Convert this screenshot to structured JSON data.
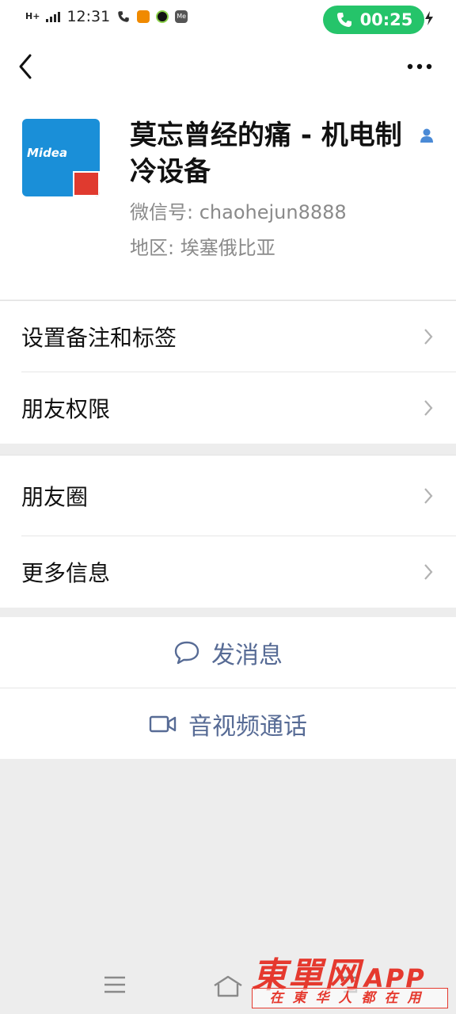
{
  "status_bar": {
    "network": "H+",
    "time": "12:31",
    "call_timer": "00:25"
  },
  "profile": {
    "display_name": "莫忘曾经的痛 - 机电制冷设备",
    "wechat_id": "微信号: chaohejun8888",
    "region": "地区: 埃塞俄比亚",
    "avatar_text": "Midea"
  },
  "menu_group_1": {
    "remark_tags": "设置备注和标签",
    "friend_permissions": "朋友权限"
  },
  "menu_group_2": {
    "moments": "朋友圈",
    "more_info": "更多信息"
  },
  "actions": {
    "send_message": "发消息",
    "video_call": "音视频通话"
  },
  "watermark": {
    "brand": "東單网",
    "app": "APP",
    "slogan": "在東华人都在用"
  },
  "colors": {
    "accent": "#576b95",
    "call_green": "#25c46a",
    "watermark_red": "#e5392e"
  }
}
